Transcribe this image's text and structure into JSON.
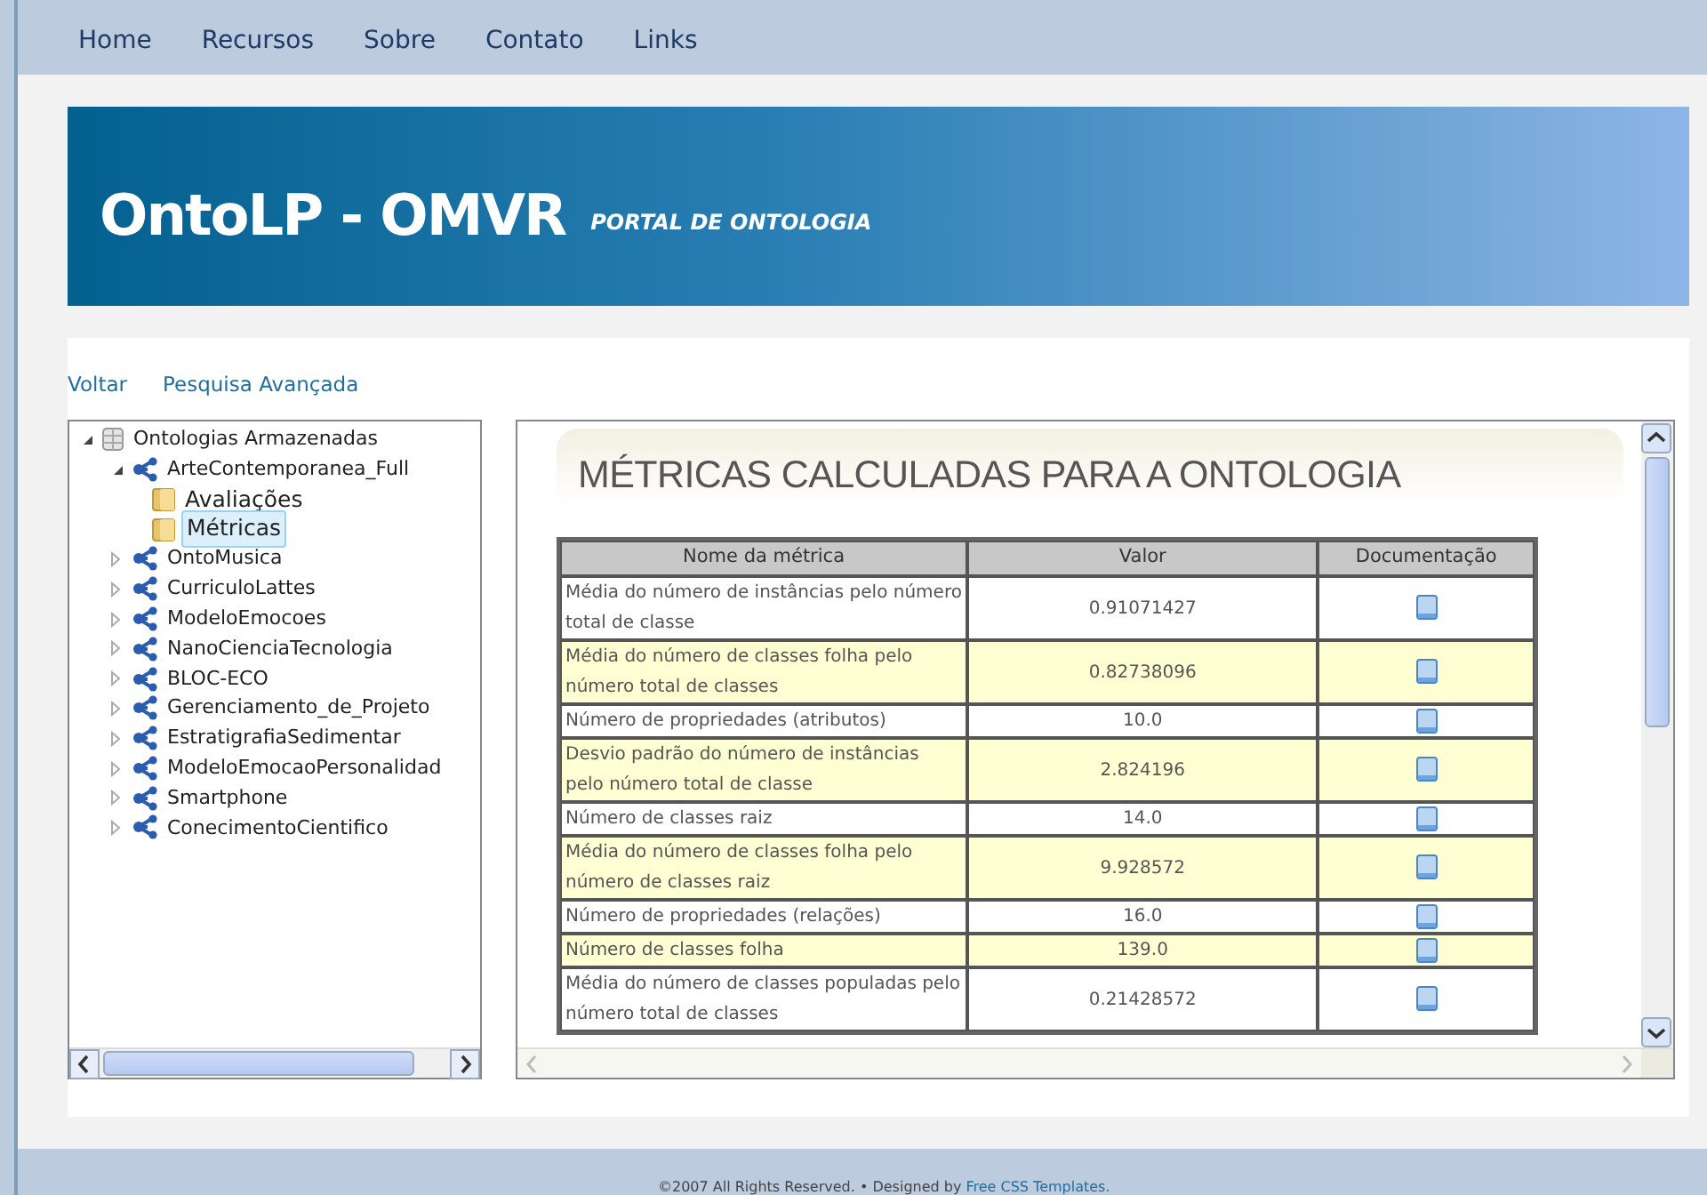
{
  "nav": [
    {
      "label": "Home"
    },
    {
      "label": "Recursos"
    },
    {
      "label": "Sobre"
    },
    {
      "label": "Contato"
    },
    {
      "label": "Links"
    }
  ],
  "banner": {
    "title": "OntoLP - OMVR",
    "subtitle": "PORTAL DE ONTOLOGIA"
  },
  "links": [
    {
      "label": "Voltar"
    },
    {
      "label": "Pesquisa Avançada"
    }
  ],
  "tree": {
    "label": "Ontologias Armazenadas",
    "kind": "database",
    "expanded": true,
    "children": [
      {
        "label": "ArteContemporanea_Full",
        "kind": "ontology",
        "expanded": true,
        "children": [
          {
            "label": "Avaliações",
            "kind": "folder",
            "selected": false
          },
          {
            "label": "Métricas",
            "kind": "folder",
            "selected": true
          }
        ]
      },
      {
        "label": "OntoMusica",
        "kind": "ontology",
        "expanded": false
      },
      {
        "label": "CurriculoLattes",
        "kind": "ontology",
        "expanded": false
      },
      {
        "label": "ModeloEmocoes",
        "kind": "ontology",
        "expanded": false
      },
      {
        "label": "NanoCienciaTecnologia",
        "kind": "ontology",
        "expanded": false
      },
      {
        "label": "BLOC-ECO",
        "kind": "ontology",
        "expanded": false
      },
      {
        "label": "Gerenciamento_de_Projeto",
        "kind": "ontology",
        "expanded": false
      },
      {
        "label": "EstratigrafiaSedimentar",
        "kind": "ontology",
        "expanded": false
      },
      {
        "label": "ModeloEmocaoPersonalidad",
        "kind": "ontology",
        "expanded": false
      },
      {
        "label": "Smartphone",
        "kind": "ontology",
        "expanded": false
      },
      {
        "label": "ConecimentoCientifico",
        "kind": "ontology",
        "expanded": false
      }
    ]
  },
  "metrics": {
    "title": "MÉTRICAS CALCULADAS PARA A ONTOLOGIA",
    "columns": [
      "Nome da métrica",
      "Valor",
      "Documentação"
    ],
    "rows": [
      {
        "name": "Média do número de instâncias pelo número total de classe",
        "value": "0.91071427"
      },
      {
        "name": "Média do número de classes folha pelo número total de classes",
        "value": "0.82738096"
      },
      {
        "name": "Número de propriedades (atributos)",
        "value": "10.0"
      },
      {
        "name": "Desvio padrão do número de instâncias pelo número total de classe",
        "value": "2.824196"
      },
      {
        "name": "Número de classes raiz",
        "value": "14.0"
      },
      {
        "name": "Média do número de classes folha pelo número de classes raiz",
        "value": "9.928572"
      },
      {
        "name": "Número de propriedades (relações)",
        "value": "16.0"
      },
      {
        "name": "Número de classes folha",
        "value": "139.0"
      },
      {
        "name": "Média do número de classes populadas pelo número total de classes",
        "value": "0.21428572"
      }
    ]
  },
  "footer": {
    "text": "©2007 All Rights Reserved. • Designed by",
    "link": "Free CSS Templates."
  }
}
